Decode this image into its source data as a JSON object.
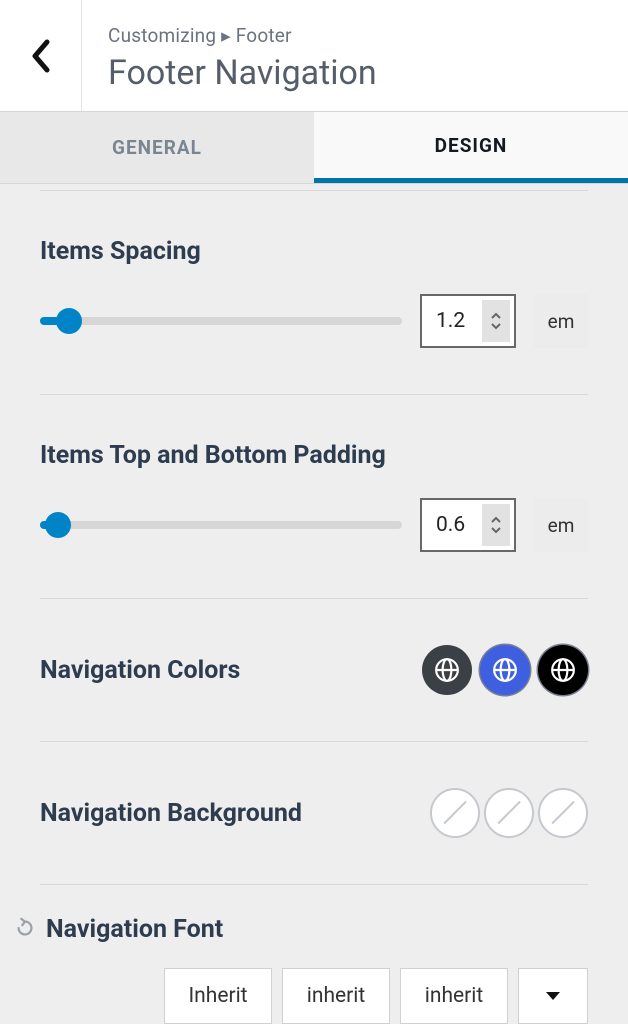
{
  "header": {
    "breadcrumb_prefix": "Customizing",
    "breadcrumb_target": "Footer",
    "title": "Footer Navigation"
  },
  "tabs": {
    "general": "GENERAL",
    "design": "DESIGN"
  },
  "spacing": {
    "title": "Items Spacing",
    "value": "1.2",
    "unit": "em",
    "slider_percent": 8
  },
  "padding": {
    "title": "Items Top and Bottom Padding",
    "value": "0.6",
    "unit": "em",
    "slider_percent": 5
  },
  "colors": {
    "title": "Navigation Colors"
  },
  "background": {
    "title": "Navigation Background"
  },
  "font": {
    "title": "Navigation Font",
    "values": [
      "Inherit",
      "inherit",
      "inherit"
    ]
  }
}
